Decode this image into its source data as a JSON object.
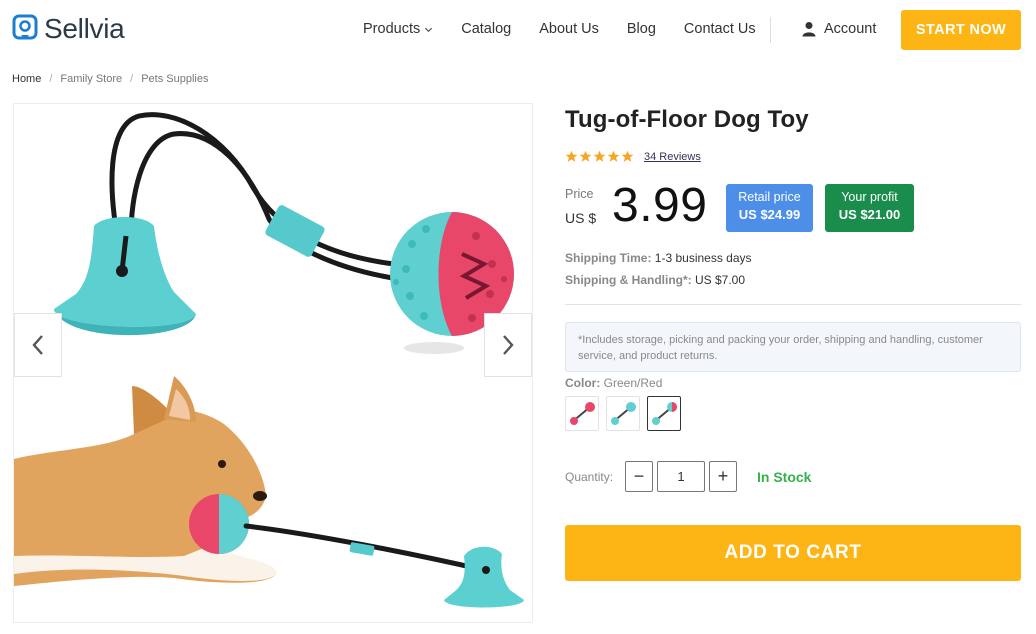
{
  "brand": {
    "name": "Sellvia",
    "accent": "#fdb515",
    "logo_color": "#1b7fd1"
  },
  "nav": {
    "items": [
      {
        "label": "Products",
        "has_dropdown": true
      },
      {
        "label": "Catalog"
      },
      {
        "label": "About Us"
      },
      {
        "label": "Blog"
      },
      {
        "label": "Contact Us"
      }
    ],
    "account_label": "Account",
    "account_icon": "user-icon",
    "cta_label": "START NOW"
  },
  "breadcrumb": {
    "items": [
      "Home",
      "Family Store",
      "Pets Supplies"
    ],
    "separator": "/"
  },
  "gallery": {
    "prev_icon": "chevron-left-icon",
    "next_icon": "chevron-right-icon"
  },
  "product": {
    "title": "Tug-of-Floor Dog Toy",
    "rating": 5,
    "reviews_label": "34 Reviews",
    "price_label": "Price",
    "currency": "US $",
    "price": "3.99",
    "retail": {
      "label": "Retail price",
      "value": "US $24.99",
      "color": "#4d8ee8"
    },
    "profit": {
      "label": "Your profit",
      "value": "US $21.00",
      "color": "#1a8c4c"
    },
    "shipping_time": {
      "label": "Shipping Time:",
      "value": "1-3 business days"
    },
    "shipping_handling": {
      "label": "Shipping & Handling*:",
      "value": "US $7.00"
    },
    "note": "*Includes storage, picking and packing your order, shipping and handling, customer service, and product returns.",
    "color": {
      "label": "Color:",
      "value": "Green/Red",
      "variant_count": 3,
      "selected_index": 2
    },
    "quantity": {
      "label": "Quantity:",
      "value": "1",
      "minus": "−",
      "plus": "+"
    },
    "stock_label": "In Stock",
    "stock_color": "#35b24a",
    "add_to_cart_label": "ADD TO CART"
  }
}
